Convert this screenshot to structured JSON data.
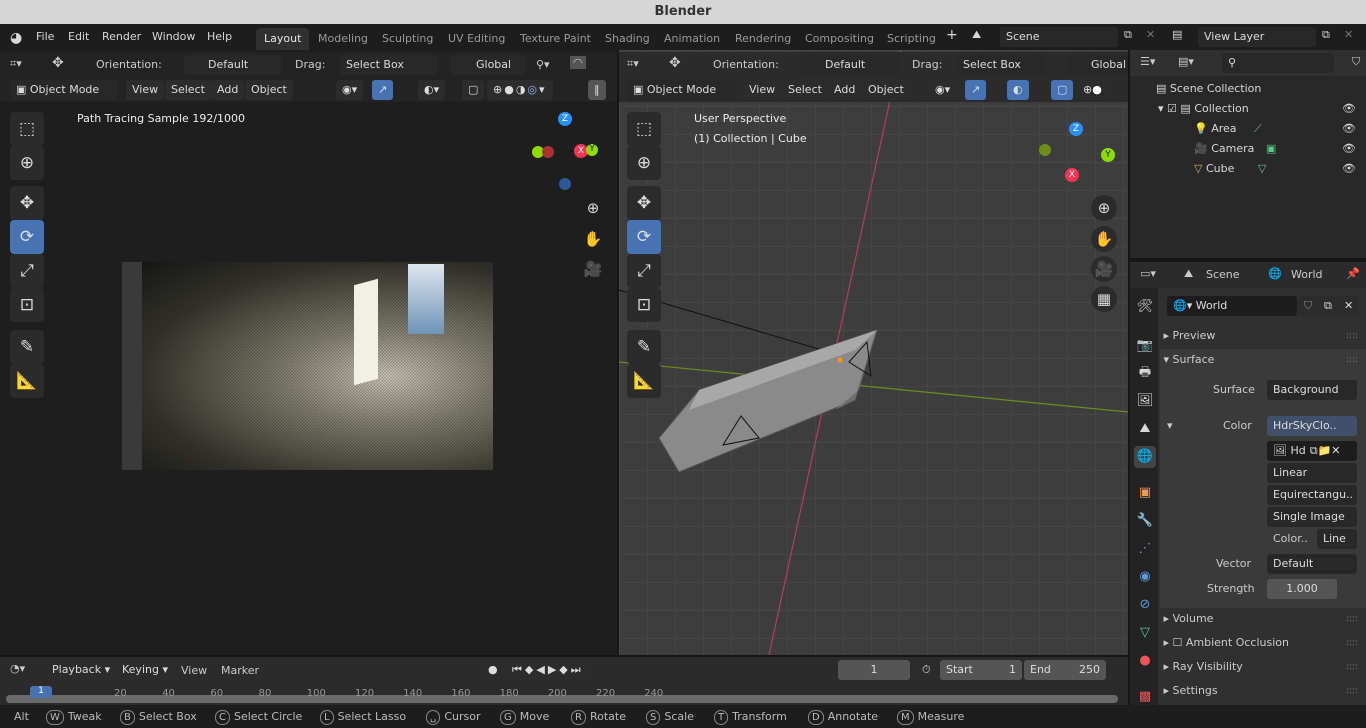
{
  "window_title": "Blender",
  "menu": [
    "File",
    "Edit",
    "Render",
    "Window",
    "Help"
  ],
  "workspaces": [
    "Layout",
    "Modeling",
    "Sculpting",
    "UV Editing",
    "Texture Paint",
    "Shading",
    "Animation",
    "Rendering",
    "Compositing",
    "Scripting"
  ],
  "active_workspace": "Layout",
  "scene": "Scene",
  "view_layer": "View Layer",
  "viewport_header": {
    "orientation_label": "Orientation:",
    "orientation": "Default",
    "drag_label": "Drag:",
    "drag": "Select Box",
    "transform": "Global",
    "mode": "Object Mode",
    "view": "View",
    "select": "Select",
    "add": "Add",
    "object": "Object"
  },
  "left_viewport": {
    "status": "Path Tracing Sample 192/1000"
  },
  "right_viewport": {
    "line1": "User Perspective",
    "line2": "(1) Collection | Cube"
  },
  "outliner": {
    "root": "Scene Collection",
    "collection": "Collection",
    "items": [
      "Area",
      "Camera",
      "Cube"
    ]
  },
  "properties": {
    "breadcrumb_scene": "Scene",
    "breadcrumb_world": "World",
    "world_name": "World",
    "panels": {
      "preview": "Preview",
      "surface": "Surface",
      "volume": "Volume",
      "ao": "Ambient Occlusion",
      "ray": "Ray Visibility",
      "settings": "Settings"
    },
    "surface_label": "Surface",
    "surface_value": "Background",
    "color_label": "Color",
    "color_value": "HdrSkyClo..",
    "image_name": "Hd",
    "interp": "Linear",
    "projection": "Equirectangu..",
    "source": "Single Image",
    "colorspace_label": "Color..",
    "colorspace": "Line",
    "vector_label": "Vector",
    "vector_value": "Default",
    "strength_label": "Strength",
    "strength_value": "1.000"
  },
  "timeline": {
    "playback": "Playback",
    "keying": "Keying",
    "view": "View",
    "marker": "Marker",
    "current_frame": "1",
    "start_label": "Start",
    "start": "1",
    "end_label": "End",
    "end": "250",
    "ticks": [
      "20",
      "40",
      "60",
      "80",
      "100",
      "120",
      "140",
      "160",
      "180",
      "200",
      "220",
      "240"
    ],
    "cursor": "1"
  },
  "statusbar": [
    [
      "Alt",
      ""
    ],
    [
      "W",
      "Tweak"
    ],
    [
      "B",
      "Select Box"
    ],
    [
      "C",
      "Select Circle"
    ],
    [
      "L",
      "Select Lasso"
    ],
    [
      "␣",
      "Cursor"
    ],
    [
      "G",
      "Move"
    ],
    [
      "R",
      "Rotate"
    ],
    [
      "S",
      "Scale"
    ],
    [
      "T",
      "Transform"
    ],
    [
      "D",
      "Annotate"
    ],
    [
      "M",
      "Measure"
    ]
  ],
  "colors": {
    "accent": "#4772b3",
    "x_axis": "#ff3352",
    "y_axis": "#8bdc00",
    "z_axis": "#2890ff"
  }
}
